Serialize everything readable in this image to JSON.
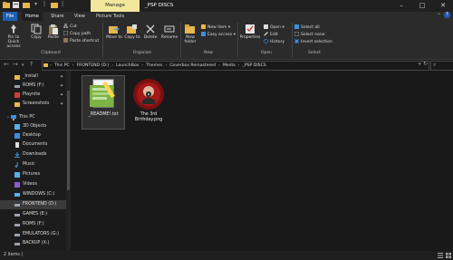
{
  "window": {
    "manage_tab": "Manage",
    "title": "_PSP DISCS",
    "minimize": "–",
    "maximize": "□",
    "close": "✕"
  },
  "tabs": [
    {
      "label": "File"
    },
    {
      "label": "Home"
    },
    {
      "label": "Share"
    },
    {
      "label": "View"
    },
    {
      "label": "Picture Tools"
    }
  ],
  "ribbon": {
    "clipboard": {
      "pin_label": "Pin to Quick access",
      "copy_label": "Copy",
      "paste_label": "Paste",
      "cut_label": "Cut",
      "copy_path_label": "Copy path",
      "paste_shortcut_label": "Paste shortcut",
      "group_label": "Clipboard"
    },
    "organize": {
      "move_to_label": "Move to",
      "copy_to_label": "Copy to",
      "delete_label": "Delete",
      "rename_label": "Rename",
      "group_label": "Organize"
    },
    "new": {
      "new_folder_label": "New folder",
      "new_item_label": "New item ▾",
      "easy_access_label": "Easy access ▾",
      "group_label": "New"
    },
    "open": {
      "properties_label": "Properties",
      "open_label": "Open ▾",
      "edit_label": "Edit",
      "history_label": "History",
      "group_label": "Open"
    },
    "select": {
      "select_all_label": "Select all",
      "select_none_label": "Select none",
      "invert_label": "Invert selection",
      "group_label": "Select"
    }
  },
  "address": {
    "breadcrumbs": [
      "This PC",
      "FRONTEND (D:)",
      "LaunchBox",
      "Themes",
      "Coverbox Remastered",
      "Media",
      "_PSP DISCS"
    ]
  },
  "nav": {
    "items": [
      {
        "label": "_Install",
        "icon": "folder-icon",
        "pinned": true
      },
      {
        "label": "ROMS (F:)",
        "icon": "drive-icon",
        "pinned": true
      },
      {
        "label": "Playnite",
        "icon": "app-icon",
        "pinned": true
      },
      {
        "label": "Screenshots",
        "icon": "folder-icon",
        "pinned": true
      },
      {
        "label": "This PC",
        "icon": "computer-icon"
      },
      {
        "label": "3D Objects",
        "icon": "3d-objects-icon"
      },
      {
        "label": "Desktop",
        "icon": "desktop-icon"
      },
      {
        "label": "Documents",
        "icon": "documents-icon"
      },
      {
        "label": "Downloads",
        "icon": "downloads-icon"
      },
      {
        "label": "Music",
        "icon": "music-icon"
      },
      {
        "label": "Pictures",
        "icon": "pictures-icon"
      },
      {
        "label": "Videos",
        "icon": "videos-icon"
      },
      {
        "label": "WINDOWS (C:)",
        "icon": "windows-drive-icon"
      },
      {
        "label": "FRONTEND (D:)",
        "icon": "drive-icon"
      },
      {
        "label": "GAMES (E:)",
        "icon": "drive-icon"
      },
      {
        "label": "ROMS (F:)",
        "icon": "drive-icon"
      },
      {
        "label": "EMULATORS (G:)",
        "icon": "drive-icon"
      },
      {
        "label": "BACKUP (X:)",
        "icon": "drive-icon"
      }
    ]
  },
  "files": [
    {
      "name": "_README!.txt",
      "icon": "text-file-icon"
    },
    {
      "name": "The 3rd Birthday.png",
      "icon": "image-file-icon"
    }
  ],
  "status": {
    "text": "2 items  |"
  },
  "colors": {
    "manage_accent": "#f3e79b",
    "folder": "#e8b84a",
    "background": "#191919"
  }
}
